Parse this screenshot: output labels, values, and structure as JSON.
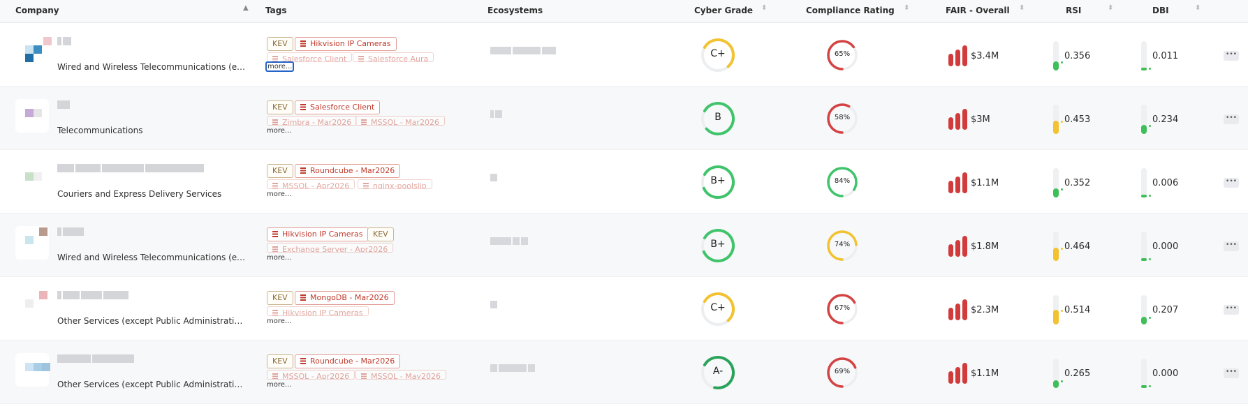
{
  "header": {
    "company": "Company",
    "tags": "Tags",
    "ecosystems": "Ecosystems",
    "cyber_grade": "Cyber Grade",
    "compliance": "Compliance Rating",
    "fair": "FAIR - Overall",
    "rsi": "RSI",
    "dbi": "DBI"
  },
  "more_label": "more...",
  "row_actions_label": "•••",
  "rows": [
    {
      "industry": "Wired and Wireless Telecommunications (except Satellite)",
      "tags": [
        "KEV",
        "Hikvision IP Cameras",
        "Salesforce Client",
        "Salesforce Aura"
      ],
      "grade": "C+",
      "compliance": "65%",
      "fair": "$3.4M",
      "rsi": "0.356",
      "dbi": "0.011"
    },
    {
      "industry": "Telecommunications",
      "tags": [
        "KEV",
        "Salesforce Client",
        "Zimbra - Mar2026",
        "MSSQL - Mar2026"
      ],
      "grade": "B",
      "compliance": "58%",
      "fair": "$3M",
      "rsi": "0.453",
      "dbi": "0.234"
    },
    {
      "industry": "Couriers and Express Delivery Services",
      "tags": [
        "KEV",
        "Roundcube - Mar2026",
        "MSSQL - Apr2026",
        "nginx-poolslip"
      ],
      "grade": "B+",
      "compliance": "84%",
      "fair": "$1.1M",
      "rsi": "0.352",
      "dbi": "0.006"
    },
    {
      "industry": "Wired and Wireless Telecommunications (except Satellite)",
      "tags": [
        "Hikvision IP Cameras",
        "KEV",
        "Exchange Server - Apr2026"
      ],
      "grade": "B+",
      "compliance": "74%",
      "fair": "$1.8M",
      "rsi": "0.464",
      "dbi": "0.000"
    },
    {
      "industry": "Other Services (except Public Administration)",
      "tags": [
        "KEV",
        "MongoDB - Mar2026",
        "Hikvision IP Cameras"
      ],
      "grade": "C+",
      "compliance": "67%",
      "fair": "$2.3M",
      "rsi": "0.514",
      "dbi": "0.207"
    },
    {
      "industry": "Other Services (except Public Administration)",
      "tags": [
        "KEV",
        "Roundcube - Mar2026",
        "MSSQL - Apr2026",
        "MSSQL - May2026"
      ],
      "grade": "A-",
      "compliance": "69%",
      "fair": "$1.1M",
      "rsi": "0.265",
      "dbi": "0.000"
    }
  ],
  "metrics": {
    "grade_fraction": [
      0.55,
      0.8,
      0.85,
      0.85,
      0.55,
      0.7
    ],
    "grade_color": [
      "#f2c230",
      "#3fc46b",
      "#3fc46b",
      "#3fc46b",
      "#f2c230",
      "#2aa35a"
    ],
    "compliance_fraction": [
      0.65,
      0.58,
      0.84,
      0.74,
      0.67,
      0.69
    ],
    "compliance_color": [
      "#d44343",
      "#d44343",
      "#3fc46b",
      "#f2c230",
      "#d44343",
      "#d44343"
    ],
    "rsi_color": [
      "#3fbf5a",
      "#f2c230",
      "#3fbf5a",
      "#f2c230",
      "#f2c230",
      "#3fbf5a"
    ],
    "rsi_fraction": [
      0.3,
      0.45,
      0.3,
      0.45,
      0.5,
      0.25
    ],
    "dbi_fraction": [
      0.1,
      0.3,
      0.1,
      0.1,
      0.25,
      0.1
    ]
  }
}
